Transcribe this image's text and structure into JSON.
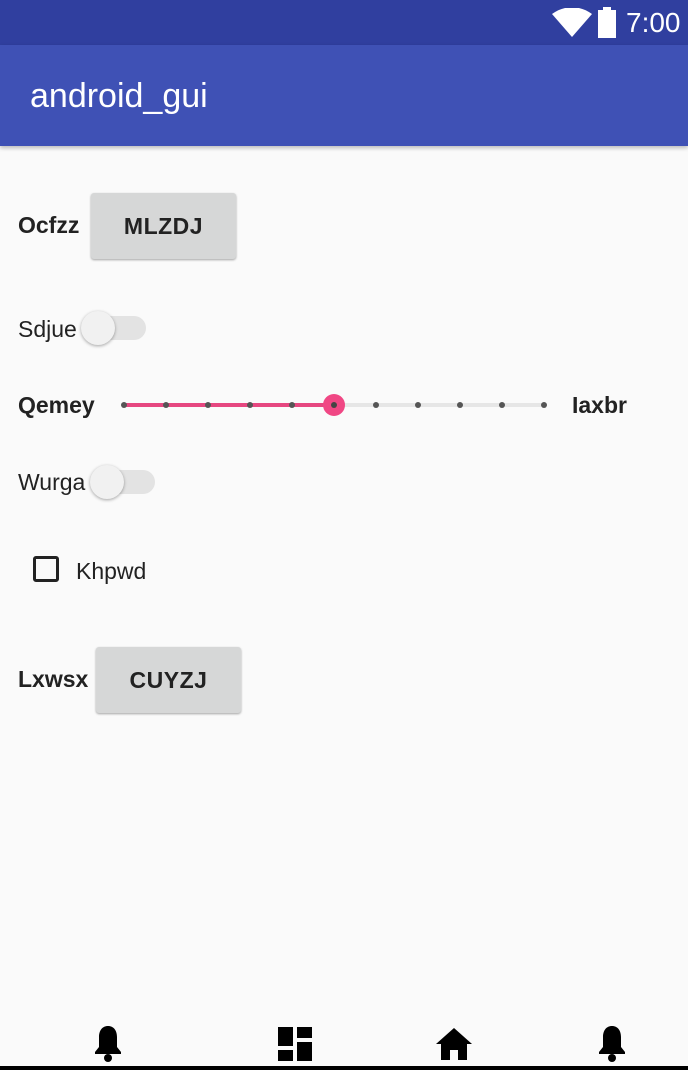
{
  "status_bar": {
    "time": "7:00",
    "icons": [
      "wifi-icon",
      "battery-icon"
    ]
  },
  "app_bar": {
    "title": "android_gui"
  },
  "rows": {
    "row1": {
      "label": "Ocfzz",
      "button": "MLZDJ"
    },
    "row2": {
      "label": "Sdjue",
      "switch_on": false
    },
    "row3": {
      "label_left": "Qemey",
      "label_right": "Iaxbr",
      "slider_level": 0.5,
      "slider_steps": 10
    },
    "row4": {
      "label": "Wurga",
      "switch_on": false
    },
    "row5": {
      "checkbox_label": "Khpwd",
      "checked": false
    },
    "row6": {
      "label": "Lxwsx",
      "button": "CUYZJ"
    }
  },
  "bottom_nav": {
    "icons": [
      "bell-icon",
      "dashboard-icon",
      "home-icon",
      "bell-icon"
    ]
  },
  "colors": {
    "status_bar": "#303f9f",
    "app_bar": "#3f51b5",
    "accent": "#f04784"
  }
}
